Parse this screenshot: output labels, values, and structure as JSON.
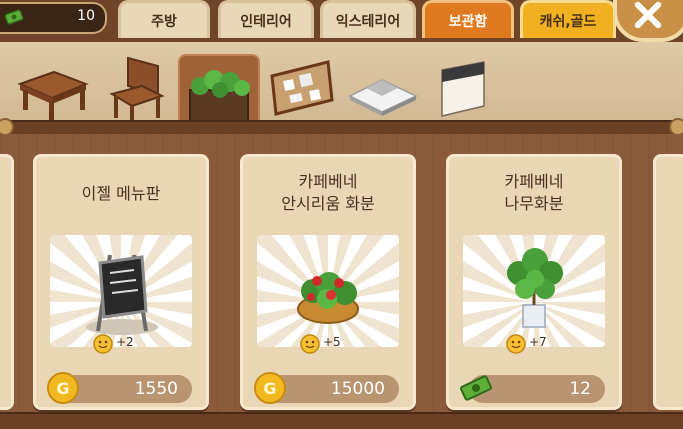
{
  "header": {
    "count": "10",
    "tabs": [
      "주방",
      "인테리어",
      "익스테리어",
      "보관함",
      "캐쉬,골드"
    ]
  },
  "categories": [
    "table",
    "chair",
    "plant",
    "board",
    "floor",
    "wall"
  ],
  "items": [
    {
      "title_line1": "이젤 메뉴판",
      "title_line2": "",
      "bonus": "+2",
      "price": "1550",
      "currency": "gold"
    },
    {
      "title_line1": "카페베네",
      "title_line2": "안시리움 화분",
      "bonus": "+5",
      "price": "15000",
      "currency": "gold"
    },
    {
      "title_line1": "카페베네",
      "title_line2": "나무화분",
      "bonus": "+7",
      "price": "12",
      "currency": "cash"
    }
  ]
}
